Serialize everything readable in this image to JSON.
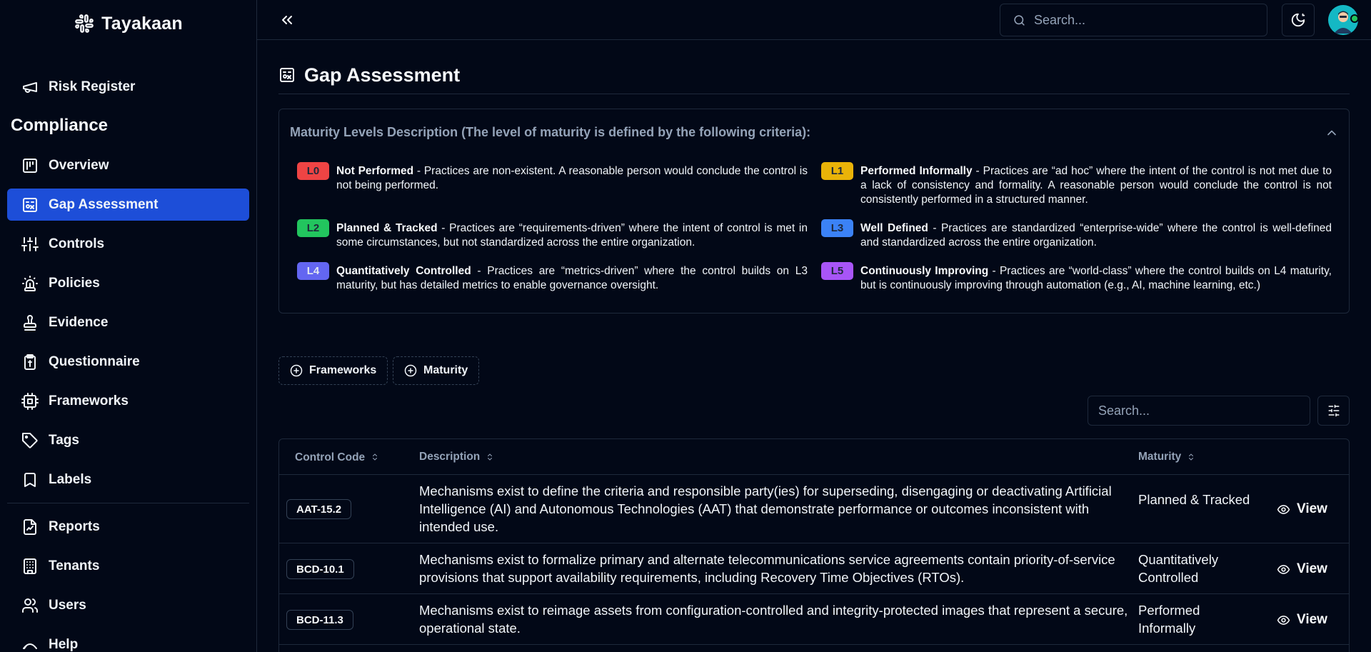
{
  "app": {
    "brand": "Tayakaan"
  },
  "sidebar": {
    "section_heading": "Compliance",
    "items": [
      {
        "label": "Risk Register",
        "icon": "megaphone-icon"
      },
      {
        "label": "Overview",
        "icon": "chart-board-icon"
      },
      {
        "label": "Gap Assessment",
        "icon": "gap-assessment-icon",
        "active": true
      },
      {
        "label": "Controls",
        "icon": "sliders-icon"
      },
      {
        "label": "Policies",
        "icon": "siren-icon"
      },
      {
        "label": "Evidence",
        "icon": "stamp-icon"
      },
      {
        "label": "Questionnaire",
        "icon": "clipboard-icon"
      },
      {
        "label": "Frameworks",
        "icon": "cpu-icon"
      },
      {
        "label": "Tags",
        "icon": "tag-icon"
      },
      {
        "label": "Labels",
        "icon": "bookmark-icon"
      },
      {
        "label": "Reports",
        "icon": "file-chart-icon"
      },
      {
        "label": "Tenants",
        "icon": "building-icon"
      },
      {
        "label": "Users",
        "icon": "users-icon"
      },
      {
        "label": "Help",
        "icon": "help-icon"
      }
    ]
  },
  "topbar": {
    "search_placeholder": "Search..."
  },
  "page": {
    "title": "Gap Assessment"
  },
  "maturity": {
    "heading": "Maturity Levels Description (The level of maturity is defined by the following criteria):",
    "levels": [
      {
        "code": "L0",
        "name": "Not Performed",
        "text": " - Practices are non-existent. A reasonable person would conclude the control is not being performed.",
        "color": "#ef4444",
        "fg": "#1e293b"
      },
      {
        "code": "L1",
        "name": "Performed Informally",
        "text": " - Practices are “ad hoc” where the intent of the control is not met due to a lack of consistency and formality. A reasonable person would conclude the control is not consistently performed in a structured manner.",
        "color": "#eab308",
        "fg": "#1e293b"
      },
      {
        "code": "L2",
        "name": "Planned & Tracked",
        "text": " - Practices are “requirements-driven” where the intent of control is met in some circumstances, but not standardized across the entire organization.",
        "color": "#22c55e",
        "fg": "#1e293b"
      },
      {
        "code": "L3",
        "name": "Well Defined",
        "text": " - Practices are standardized “enterprise-wide” where the control is well-defined and standardized across the entire organization.",
        "color": "#3b82f6",
        "fg": "#1e293b"
      },
      {
        "code": "L4",
        "name": "Quantitatively Controlled",
        "text": " - Practices are “metrics-driven” where the control builds on L3 maturity, but has detailed metrics to enable governance oversight.",
        "color": "#6366f1",
        "fg": "#e2e8f0"
      },
      {
        "code": "L5",
        "name": "Continuously Improving",
        "text": " - Practices are “world-class” where the control builds on L4 maturity, but is continuously improving through automation (e.g., AI, machine learning, etc.)",
        "color": "#a855f7",
        "fg": "#1e293b"
      }
    ]
  },
  "filters": {
    "frameworks": "Frameworks",
    "maturity": "Maturity"
  },
  "table": {
    "search_placeholder": "Search...",
    "columns": {
      "code": "Control Code",
      "description": "Description",
      "maturity": "Maturity"
    },
    "view_label": "View",
    "rows": [
      {
        "code": "AAT-15.2",
        "description": "Mechanisms exist to define the criteria and responsible party(ies) for superseding, disengaging or deactivating Artificial Intelligence (AI) and Autonomous Technologies (AAT) that demonstrate performance or outcomes inconsistent with intended use.",
        "maturity": "Planned & Tracked"
      },
      {
        "code": "BCD-10.1",
        "description": "Mechanisms exist to formalize primary and alternate telecommunications service agreements contain priority-of-service provisions that support availability requirements, including Recovery Time Objectives (RTOs).",
        "maturity": "Quantitatively Controlled"
      },
      {
        "code": "BCD-11.3",
        "description": "Mechanisms exist to reimage assets from configuration-controlled and integrity-protected images that represent a secure, operational state.",
        "maturity": "Performed Informally"
      }
    ]
  }
}
